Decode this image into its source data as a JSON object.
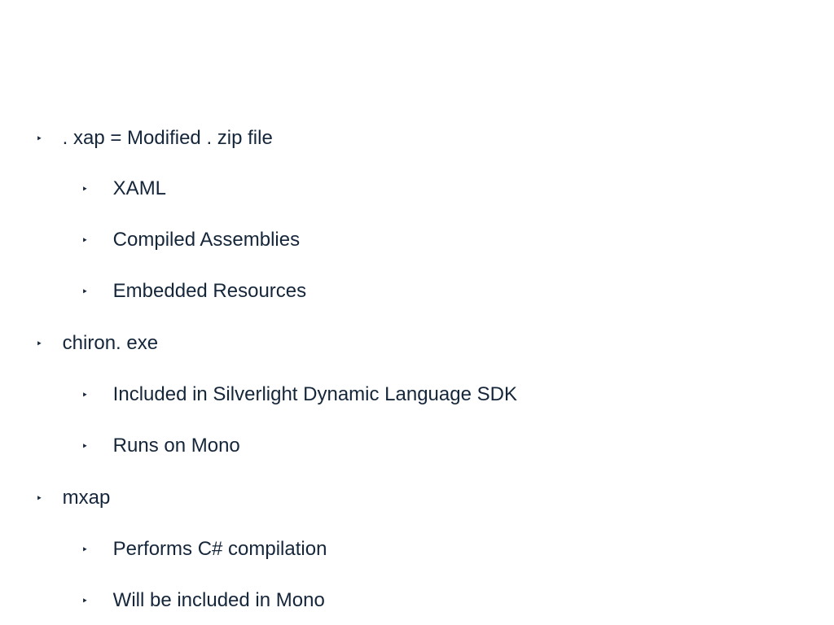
{
  "bullet_glyph": "‣",
  "items": [
    {
      "label": ". xap = Modified . zip file",
      "children": [
        {
          "label": "XAML"
        },
        {
          "label": "Compiled Assemblies"
        },
        {
          "label": "Embedded Resources"
        }
      ]
    },
    {
      "label": " chiron. exe",
      "children": [
        {
          "label": "Included in Silverlight Dynamic Language SDK"
        },
        {
          "label": "Runs on Mono"
        }
      ]
    },
    {
      "label": " mxap",
      "children": [
        {
          "label": "Performs C# compilation"
        },
        {
          "label": "Will be included in Mono"
        }
      ]
    }
  ]
}
